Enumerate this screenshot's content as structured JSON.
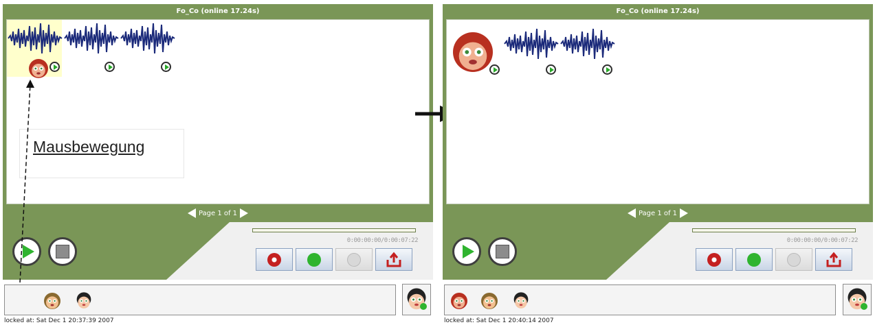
{
  "left": {
    "title": "Fo_Co (online 17.24s)",
    "pager": "Page 1 of 1",
    "timer": "0:00:00:00/0:00:07:22",
    "locked": "locked at: Sat Dec 1 20:37:39 2007",
    "annotation": "Mausbewegung",
    "recordings": 3
  },
  "right": {
    "title": "Fo_Co (online 17.24s)",
    "pager": "Page 1 of 1",
    "timer": "0:00:00:00/0:00:07:22",
    "locked": "locked at: Sat Dec 1 20:40:14 2007",
    "recordings": 3
  },
  "colors": {
    "panel": "#7a9657",
    "wave": "#1b2a7a",
    "record": "#c42020",
    "play": "#2fb42f",
    "highlight": "#ffffcc"
  },
  "icons": [
    "play-icon",
    "stop-icon",
    "record-icon",
    "upload-icon",
    "avatar-icon",
    "add-user-icon",
    "arrow-icon"
  ]
}
